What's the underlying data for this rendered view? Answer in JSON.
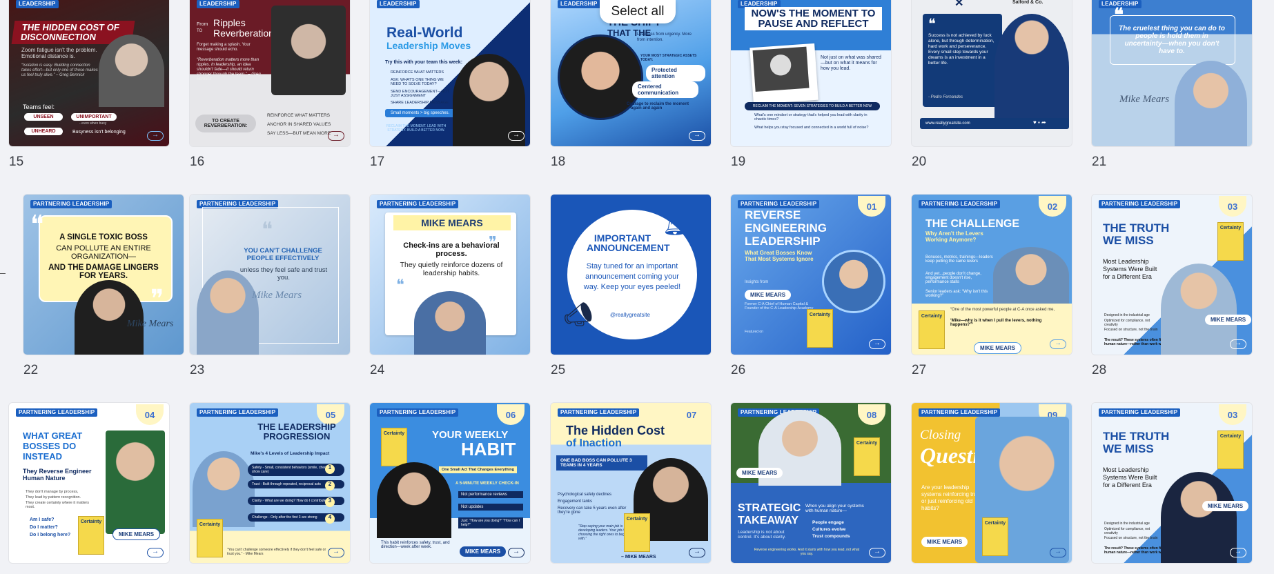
{
  "cards": {
    "c15": {
      "number": "15",
      "brand": "LEADERSHIP",
      "title": "THE HIDDEN COST OF DISCONNECTION",
      "body": "Zoom fatigue isn't the problem. Emotional distance is.",
      "quote": "“Isolation is easy. Building connection takes effort—but only one of those makes us feel truly alive.” – Greg Bennick",
      "teams_label": "Teams feel:",
      "words": [
        "UNSEEN",
        "UNIMPORTANT",
        "UNHEARD"
      ],
      "note": "- even when busy",
      "footer": "Busyness isn't belonging"
    },
    "c16": {
      "number": "16",
      "brand": "LEADERSHIP",
      "from": "From",
      "to": "TO",
      "title1": "Ripples",
      "title2": "Reverberation",
      "sub": "Forget making a splash. Your message should echo.",
      "quote": "“Reverberation matters more than ripples. In leadership, an idea shouldn't fade—it should return stronger through the team.” – Greg Bennick",
      "cta": "TO CREATE REVERBERATION:",
      "list": [
        "REINFORCE WHAT MATTERS",
        "ANCHOR IN SHARED VALUES",
        "SAY LESS—BUT MEAN MORE"
      ]
    },
    "c17": {
      "number": "17",
      "brand": "LEADERSHIP",
      "title1": "Real-World",
      "title2": "Leadership Moves",
      "lead": "Try this with your team this week:",
      "list": [
        "REINFORCE WHAT MATTERS",
        "ASK: WHAT'S ONE THING WE NEED TO SOLVE TODAY?",
        "SEND ENCOURAGEMENT—NOT JUST ASSIGNMENT",
        "SHARE LEADERSHIP MESSAGE"
      ],
      "chip": "Small moments > big speeches.",
      "footer": "RECLAIM THE MOMENT. LEAD WITH STRATEGY. BUILD A BETTER NOW."
    },
    "c18": {
      "number": "18",
      "brand": "LEADERSHIP",
      "title": "THE SHIFT",
      "title2": "THAT THE",
      "sub": "Lead less from urgency. More from intention.",
      "q": "YOUR MOST STRATEGIC ASSETS TODAY:",
      "items": [
        "Protected attention",
        "Centered communication",
        "Courage to reclaim the moment—again and again"
      ]
    },
    "c19": {
      "number": "19",
      "brand": "LEADERSHIP",
      "title": "NOW'S THE MOMENT TO PAUSE AND REFLECT",
      "side": "Not just on what was shared—but on what it means for how you lead.",
      "banner": "RECLAIM THE MOMENT: SEVEN STRATEGIES TO BUILD A BETTER NOW",
      "q1": "What's one mindset or strategy that's helped you lead with clarity in chaotic times?",
      "q2": "What helps you stay focused and connected in a world full of noise?"
    },
    "c20": {
      "number": "20",
      "brand": "Salford & Co.",
      "quote": "Success is not achieved by luck alone, but through determination, hard work and perseverance. Every small step towards your dreams is an investment in a better life.",
      "author": "- Pedro Fernandes",
      "url": "www.reallygreatsite.com"
    },
    "c21": {
      "number": "21",
      "brand": "LEADERSHIP",
      "quote": "The cruelest thing you can do to people is hold them in uncertainty—when you don't have to.",
      "signature": "Mike Mears"
    },
    "c22": {
      "number": "22",
      "brand": "PARTNERING LEADERSHIP",
      "line1": "A SINGLE TOXIC BOSS",
      "line2": "CAN POLLUTE AN ENTIRE ORGANIZATION—",
      "line3": "AND THE DAMAGE LINGERS FOR YEARS.",
      "signature": "Mike Mears"
    },
    "c23": {
      "number": "23",
      "brand": "PARTNERING LEADERSHIP",
      "line1": "YOU CAN'T CHALLENGE PEOPLE EFFECTIVELY",
      "line2": "unless they feel safe and trust you.",
      "signature": "Mike Mears"
    },
    "c24": {
      "number": "24",
      "brand": "PARTNERING LEADERSHIP",
      "name": "MIKE MEARS",
      "bold": "Check-ins are a behavioral process.",
      "rest": "They quietly reinforce dozens of leadership habits."
    },
    "c25": {
      "number": "25",
      "title": "IMPORTANT ANNOUNCEMENT",
      "body": "Stay tuned for an important announcement coming your way. Keep your eyes peeled!",
      "handle": "@reallygreatsite"
    },
    "c26": {
      "number": "26",
      "badge": "01",
      "brand": "PARTNERING LEADERSHIP",
      "title": "REVERSE ENGINEERING LEADERSHIP",
      "sub": "What Great Bosses Know That Most Systems Ignore",
      "insights": "Insights from",
      "name": "MIKE MEARS",
      "bio": "Former C-A Chief of Human Capital & Founder of the C-A Leadership Academy",
      "featured": "Featured on",
      "book": "Certainty"
    },
    "c27": {
      "number": "27",
      "badge": "02",
      "brand": "PARTNERING LEADERSHIP",
      "title": "THE CHALLENGE",
      "sub": "Why Aren't the Levers Working Anymore?",
      "list": [
        "Bonuses, metrics, trainings—leaders keep pulling the same levers",
        "And yet...people don't change, engagement doesn't rise, performance stalls",
        "Senior leaders ask: “Why isn't this working?”"
      ],
      "quote": "“One of the most powerful people at C-A once asked me,",
      "quote_bold": "‘Mike—why is it when I pull the levers, nothing happens?’”",
      "name": "MIKE MEARS",
      "book": "Certainty"
    },
    "c28": {
      "number": "28",
      "badge": "03",
      "brand": "PARTNERING LEADERSHIP",
      "title": "THE TRUTH WE MISS",
      "sub": "Most Leadership Systems Were Built for a Different Era",
      "list": [
        "Designed in the industrial age",
        "Optimized for compliance, not creativity",
        "Focused on structure, not the brain"
      ],
      "result": "The result? These systems often fight human nature—rather than work with it",
      "name": "MIKE MEARS",
      "book": "Certainty"
    },
    "c29": {
      "badge": "04",
      "brand": "PARTNERING LEADERSHIP",
      "title": "WHAT GREAT BOSSES DO INSTEAD",
      "sub": "They Reverse Engineer Human Nature",
      "list": [
        "They don't manage by process,",
        "They lead by pattern recognition.",
        "They create certainty where it matters most."
      ],
      "checks": [
        "Am I safe?",
        "Do I matter?",
        "Do I belong here?"
      ],
      "name": "MIKE MEARS",
      "book": "Certainty"
    },
    "c30": {
      "badge": "05",
      "brand": "PARTNERING LEADERSHIP",
      "title": "THE LEADERSHIP PROGRESSION",
      "sub": "Mike's 4 Levels of Leadership Impact",
      "levels": [
        "Safety - Small, consistent behaviors (smile, check in, show care)",
        "Trust - Built through repeated, reciprocal acts",
        "Clarity - What are we doing? How do I contribute?",
        "Challenge - Only after the first 3 are strong"
      ],
      "level_nums": [
        "1",
        "2",
        "3",
        "4"
      ],
      "quote": "“You can't challenge someone effectively if they don't feel safe or trust you.” - Mike Mears",
      "book": "Certainty"
    },
    "c31": {
      "badge": "06",
      "brand": "PARTNERING LEADERSHIP",
      "title1": "YOUR WEEKLY",
      "title2": "HABIT",
      "strip": "One Small Act That Changes Everything",
      "lead": "A 5-MINUTE WEEKLY CHECK-IN",
      "checks": [
        "Not performance reviews",
        "Not updates",
        "Just: “How are you doing?” “How can I help?”"
      ],
      "body": "This habit reinforces safety, trust, and direction—week after week.",
      "name": "MIKE MEARS",
      "book": "Certainty"
    },
    "c32": {
      "badge": "07",
      "brand": "PARTNERING LEADERSHIP",
      "title1": "The Hidden Cost",
      "title2": "of Inaction",
      "strip": "ONE BAD BOSS CAN POLLUTE 3 TEAMS IN 4 YEARS",
      "list": [
        "Psychological safety declines",
        "Engagement tanks",
        "Recovery can take 5 years even after they're gone"
      ],
      "quote": "“Stop saying your main job is developing leaders. Your job is choosing the right ones to begin with.”",
      "name": "– MIKE MEARS",
      "book": "Certainty"
    },
    "c33": {
      "badge": "08",
      "brand": "PARTNERING LEADERSHIP",
      "name": "MIKE MEARS",
      "title": "STRATEGIC TAKEAWAY",
      "body": "Leadership is not about control. It's about clarity.",
      "side": "When you align your systems with human nature—",
      "list": [
        "People engage",
        "Cultures evolve",
        "Trust compounds"
      ],
      "footer": "Reverse engineering works. And it starts with how you lead, not what you say.",
      "book": "Certainty"
    },
    "c34": {
      "badge": "09",
      "brand": "PARTNERING LEADERSHIP",
      "title1": "Closing",
      "title2": "Question",
      "body": "Are your leadership systems reinforcing trust—or just reinforcing old habits?",
      "name": "MIKE MEARS",
      "book": "Certainty"
    },
    "c35": {
      "badge": "03",
      "brand": "PARTNERING LEADERSHIP",
      "title": "THE TRUTH WE MISS",
      "sub": "Most Leadership Systems Were Built for a Different Era",
      "list": [
        "Designed in the industrial age",
        "Optimized for compliance, not creativity",
        "Focused on structure, not the brain"
      ],
      "result": "The result? These systems often fight human nature—rather than work with it",
      "name": "MIKE MEARS",
      "book": "Certainty"
    }
  },
  "overlay": {
    "select_all": "Select all"
  },
  "colors": {
    "background": "#f1f2f6",
    "brand_blue": "#1b5fbf",
    "badge_yellow": "#fff6c4"
  }
}
